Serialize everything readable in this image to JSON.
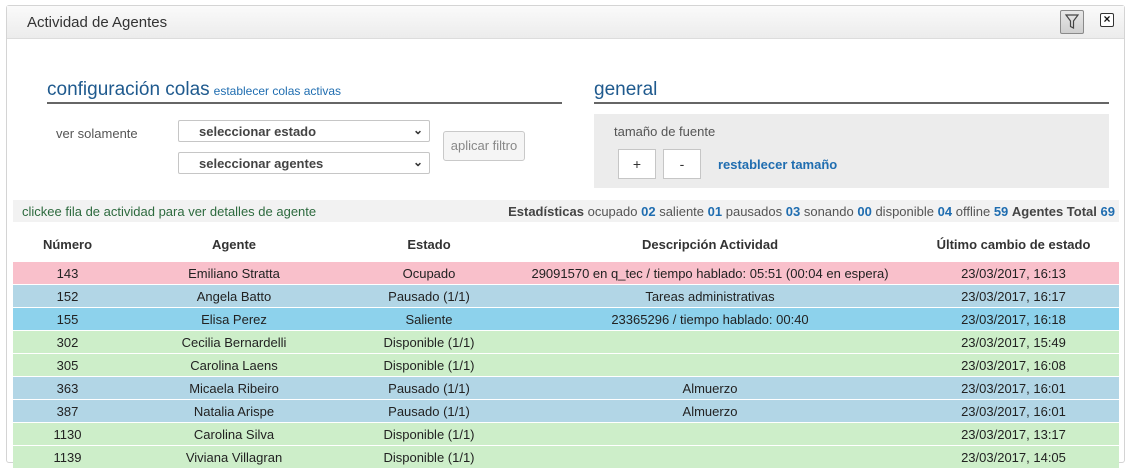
{
  "window": {
    "title": "Actividad de Agentes"
  },
  "config": {
    "heading": "configuración colas",
    "link": "establecer colas activas",
    "filter_label": "ver solamente",
    "state_select": "seleccionar estado",
    "agents_select": "seleccionar agentes",
    "apply_button": "aplicar filtro"
  },
  "general": {
    "heading": "general",
    "font_size_label": "tamaño de fuente",
    "plus": "+",
    "minus": "-",
    "reset_link": "restablecer tamaño"
  },
  "info": {
    "hint": "clickee fila de actividad para ver detalles de agente",
    "stats_label": "Estadísticas",
    "ocupado_label": "ocupado",
    "ocupado": "02",
    "saliente_label": "saliente",
    "saliente": "01",
    "pausados_label": "pausados",
    "pausados": "03",
    "sonando_label": "sonando",
    "sonando": "00",
    "disponible_label": "disponible",
    "disponible": "04",
    "offline_label": "offline",
    "offline": "59",
    "total_label": "Agentes Total",
    "total": "69"
  },
  "table": {
    "headers": [
      "Número",
      "Agente",
      "Estado",
      "Descripción Actividad",
      "Último cambio de estado"
    ],
    "rows": [
      {
        "status": "ocupado",
        "cells": [
          "143",
          "Emiliano Stratta",
          "Ocupado",
          "29091570 en q_tec / tiempo hablado: 05:51 (00:04 en espera)",
          "23/03/2017, 16:13"
        ]
      },
      {
        "status": "pausado",
        "cells": [
          "152",
          "Angela Batto",
          "Pausado (1/1)",
          "Tareas administrativas",
          "23/03/2017, 16:17"
        ]
      },
      {
        "status": "saliente",
        "cells": [
          "155",
          "Elisa Perez",
          "Saliente",
          "23365296 / tiempo hablado: 00:40",
          "23/03/2017, 16:18"
        ]
      },
      {
        "status": "disponible",
        "cells": [
          "302",
          "Cecilia Bernardelli",
          "Disponible (1/1)",
          "",
          "23/03/2017, 15:49"
        ]
      },
      {
        "status": "disponible",
        "cells": [
          "305",
          "Carolina Laens",
          "Disponible (1/1)",
          "",
          "23/03/2017, 16:08"
        ]
      },
      {
        "status": "pausado",
        "cells": [
          "363",
          "Micaela Ribeiro",
          "Pausado (1/1)",
          "Almuerzo",
          "23/03/2017, 16:01"
        ]
      },
      {
        "status": "pausado",
        "cells": [
          "387",
          "Natalia Arispe",
          "Pausado (1/1)",
          "Almuerzo",
          "23/03/2017, 16:01"
        ]
      },
      {
        "status": "disponible",
        "cells": [
          "1130",
          "Carolina Silva",
          "Disponible (1/1)",
          "",
          "23/03/2017, 13:17"
        ]
      },
      {
        "status": "disponible",
        "cells": [
          "1139",
          "Viviana Villagran",
          "Disponible (1/1)",
          "",
          "23/03/2017, 14:05"
        ]
      }
    ]
  },
  "colors": {
    "ocupado": "#f9c0cb",
    "pausado": "#b2d6e6",
    "saliente": "#8dd2ec",
    "disponible": "#cdeec9",
    "accent": "#1f5a8e"
  }
}
